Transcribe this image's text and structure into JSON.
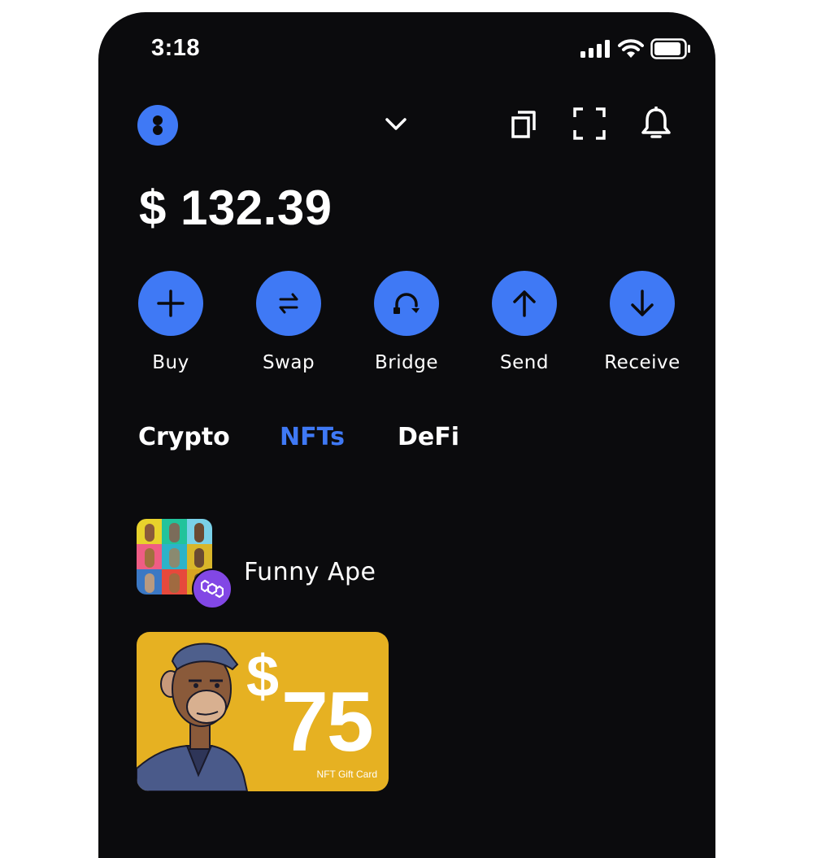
{
  "status_bar": {
    "time": "3:18",
    "icons": [
      "signal-icon",
      "wifi-icon",
      "battery-icon"
    ]
  },
  "header": {
    "icons": [
      "account-avatar",
      "chevron-down-icon",
      "copy-icon",
      "scan-icon",
      "bell-icon"
    ]
  },
  "balance": {
    "amount": "$ 132.39"
  },
  "actions": [
    {
      "label": "Buy",
      "icon": "plus-icon"
    },
    {
      "label": "Swap",
      "icon": "swap-icon"
    },
    {
      "label": "Bridge",
      "icon": "bridge-icon"
    },
    {
      "label": "Send",
      "icon": "arrow-up-icon"
    },
    {
      "label": "Receive",
      "icon": "arrow-down-icon"
    }
  ],
  "tabs": [
    {
      "label": "Crypto",
      "active": false
    },
    {
      "label": "NFTs",
      "active": true
    },
    {
      "label": "DeFi",
      "active": false
    }
  ],
  "nfts": {
    "collection": {
      "name": "Funny Ape",
      "badge": "polygon-icon"
    },
    "card": {
      "currency": "$",
      "amount": "75",
      "caption": "NFT Gift Card"
    }
  },
  "colors": {
    "background": "#0b0b0d",
    "accent": "#3f79f5",
    "card": "#e6b122",
    "badge": "#8247e5"
  }
}
